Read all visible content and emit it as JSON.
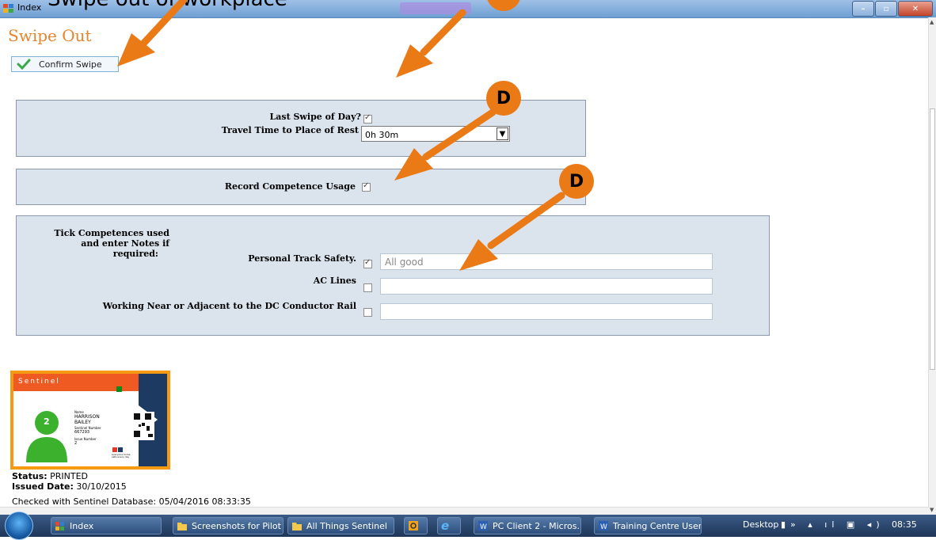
{
  "window": {
    "title": "Index",
    "overlay_text": "Swipe out of workplace"
  },
  "page": {
    "title": "Swipe Out",
    "confirm_label": "Confirm Swipe"
  },
  "rest_panel": {
    "last_swipe_label": "Last Swipe of Day?",
    "last_swipe_checked": true,
    "travel_label": "Travel Time to Place of Rest",
    "travel_value": "0h 30m"
  },
  "competence_panel": {
    "label": "Record Competence Usage",
    "checked": true
  },
  "competences": {
    "intro": [
      "Tick Competences used",
      "and enter Notes if",
      "required:"
    ],
    "items": [
      {
        "label": "Personal Track Safety.",
        "checked": true,
        "note": "All good"
      },
      {
        "label": "AC Lines",
        "checked": false,
        "note": ""
      },
      {
        "label": "Working Near or Adjacent to the DC Conductor Rail",
        "checked": false,
        "note": ""
      }
    ]
  },
  "annotations": {
    "badge_label": "D",
    "color": "#ea7a16"
  },
  "card": {
    "brand": "Sentinel",
    "name_label": "Name",
    "name_first": "HARRISON",
    "name_last": "BAILEY",
    "number_label": "Sentinel Number",
    "number": "667293",
    "issue_label": "Issue Number",
    "issue": "2",
    "tagline": "everyone home safe every day"
  },
  "status": {
    "status_label": "Status:",
    "status_value": "PRINTED",
    "issued_label": "Issued Date:",
    "issued_value": "30/10/2015",
    "checked_text": "Checked with Sentinel Database: 05/04/2016 08:33:35"
  },
  "taskbar": {
    "items": [
      "Index",
      "Screenshots for Pilot",
      "All Things Sentinel",
      "",
      "",
      "PC Client 2 - Micros...",
      "Training Centre User ..."
    ],
    "desktop": "Desktop",
    "clock": "08:35"
  }
}
